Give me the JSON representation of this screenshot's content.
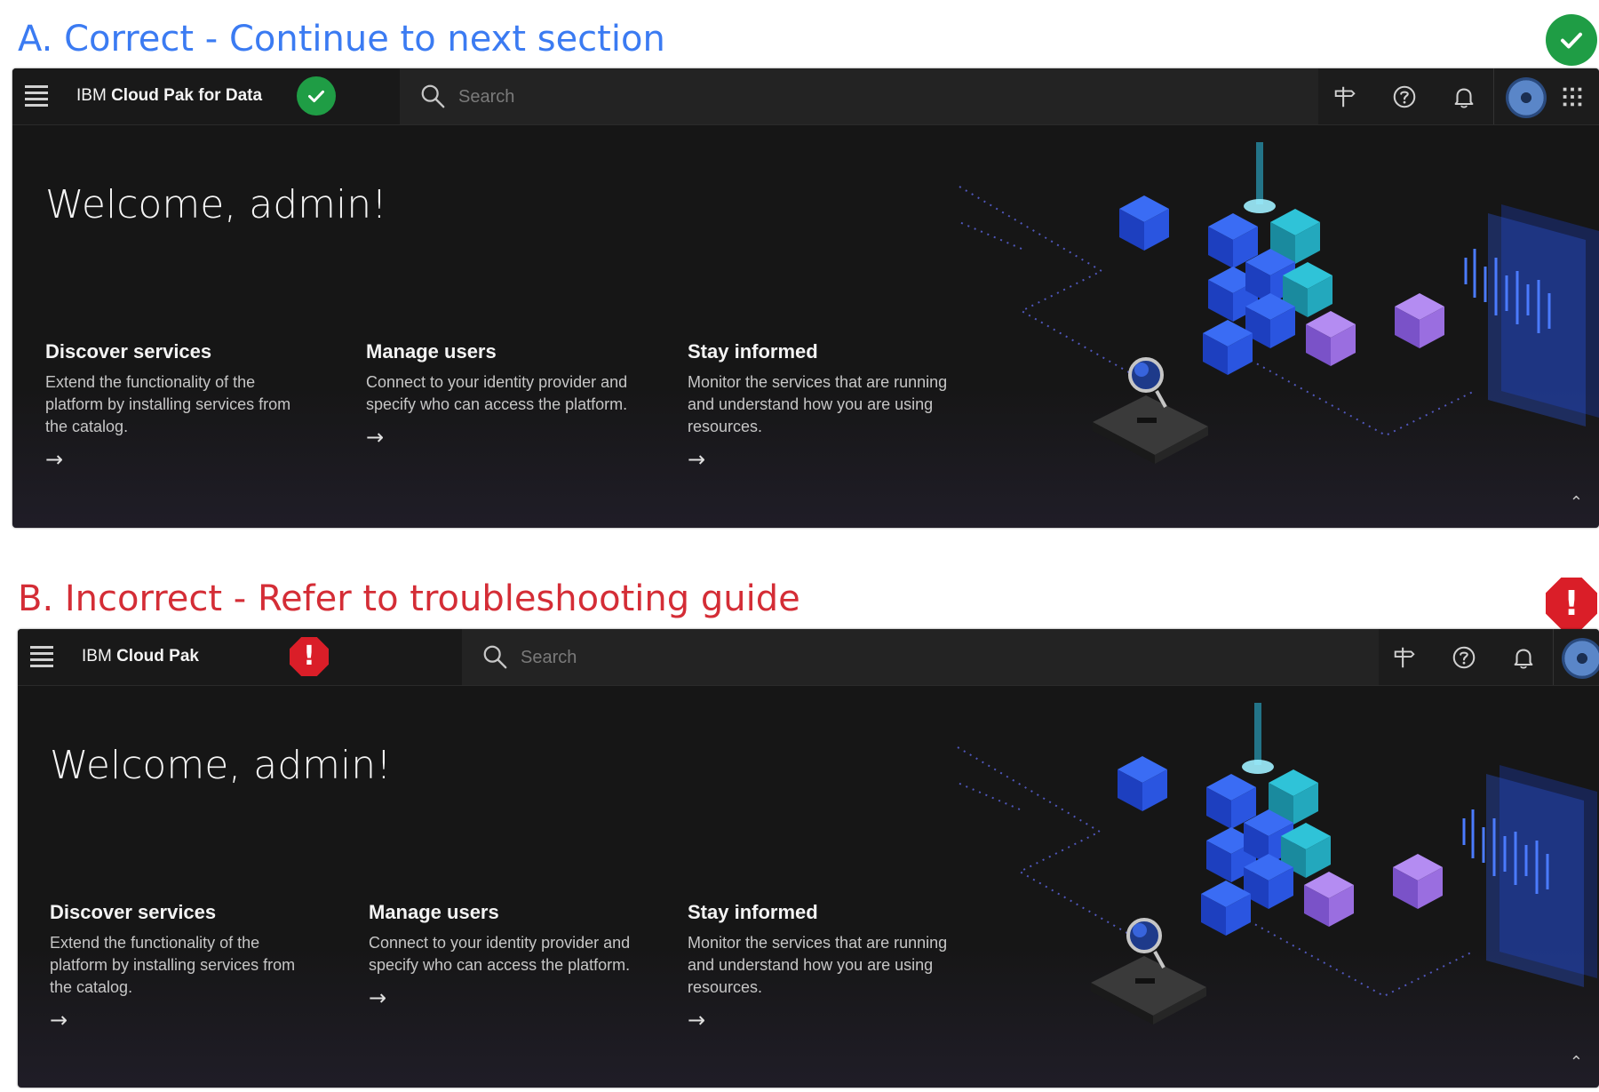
{
  "captions": {
    "correct": "A. Correct - Continue to next section",
    "incorrect": "B. Incorrect - Refer to troubleshooting guide"
  },
  "colors": {
    "correct": "#3b7bf2",
    "incorrect": "#d42d36",
    "success_badge": "#1f9d45",
    "error_badge": "#da1e28",
    "panel_bg": "#161616"
  },
  "icons": {
    "menu": "hamburger-icon",
    "search": "search-icon",
    "pin": "signpost-icon",
    "help": "help-icon",
    "notifications": "bell-icon",
    "switcher": "app-switcher-icon",
    "check": "checkmark-icon",
    "error": "exclamation-icon"
  },
  "screenA": {
    "brand_prefix": "IBM",
    "brand_name": "Cloud Pak for Data",
    "search_placeholder": "Search",
    "welcome": "Welcome, admin!",
    "features": [
      {
        "title": "Discover services",
        "desc": "Extend the functionality of the platform by installing services from the catalog.",
        "arrow": "→"
      },
      {
        "title": "Manage users",
        "desc": "Connect to your identity provider and specify who can access the platform.",
        "arrow": "→"
      },
      {
        "title": "Stay informed",
        "desc": "Monitor the services that are running and understand how you are using resources.",
        "arrow": "→"
      }
    ],
    "collapse": "⌃"
  },
  "screenB": {
    "brand_prefix": "IBM",
    "brand_name": "Cloud Pak",
    "search_placeholder": "Search",
    "welcome": "Welcome, admin!",
    "features": [
      {
        "title": "Discover services",
        "desc": "Extend the functionality of the platform by installing services from the catalog.",
        "arrow": "→"
      },
      {
        "title": "Manage users",
        "desc": "Connect to your identity provider and specify who can access the platform.",
        "arrow": "→"
      },
      {
        "title": "Stay informed",
        "desc": "Monitor the services that are running and understand how you are using resources.",
        "arrow": "→"
      }
    ],
    "collapse": "⌃"
  },
  "badges": {
    "error_mark": "!"
  }
}
